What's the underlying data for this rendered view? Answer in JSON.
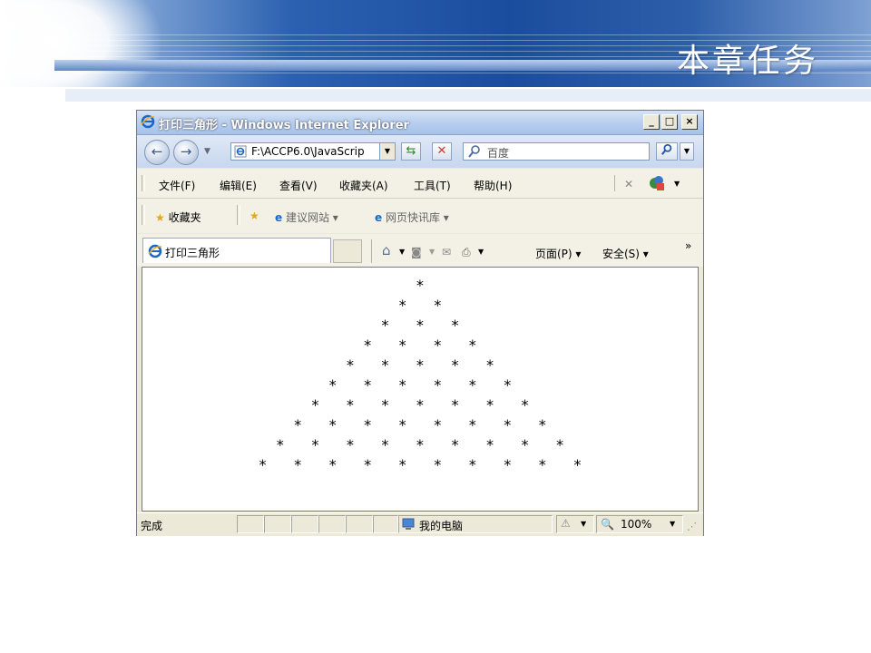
{
  "slide": {
    "title": "本章任务"
  },
  "window": {
    "title": "打印三角形 - Windows Internet Explorer",
    "buttons": {
      "minimize": "_",
      "maximize": "□",
      "close": "×"
    }
  },
  "address_bar": {
    "url": "F:\\ACCP6.0\\JavaScrip",
    "search_placeholder": "百度"
  },
  "menu": {
    "items": [
      "文件(F)",
      "编辑(E)",
      "查看(V)",
      "收藏夹(A)",
      "工具(T)",
      "帮助(H)"
    ]
  },
  "favorites_bar": {
    "favorites_label": "收藏夹",
    "suggested_sites": "建议网站 ▾",
    "web_slices": "网页快讯库 ▾"
  },
  "tabs": {
    "active_tab": "打印三角形"
  },
  "command_bar": {
    "page": "页面(P) ▾",
    "safety": "安全(S) ▾",
    "more": "»"
  },
  "content": {
    "rows": [
      "*",
      "*   *",
      "*   *   *",
      "*   *   *   *",
      "*   *   *   *   *",
      "*   *   *   *   *   *",
      "*   *   *   *   *   *   *",
      "*   *   *   *   *   *   *   *",
      "*   *   *   *   *   *   *   *   *",
      "*   *   *   *   *   *   *   *   *   *"
    ]
  },
  "status_bar": {
    "status": "完成",
    "zone": "我的电脑",
    "zoom": "100%"
  },
  "colors": {
    "banner_dark": "#1b4d9e",
    "titlebar": "#b8cfee",
    "close_button_red": "#d0372f"
  }
}
